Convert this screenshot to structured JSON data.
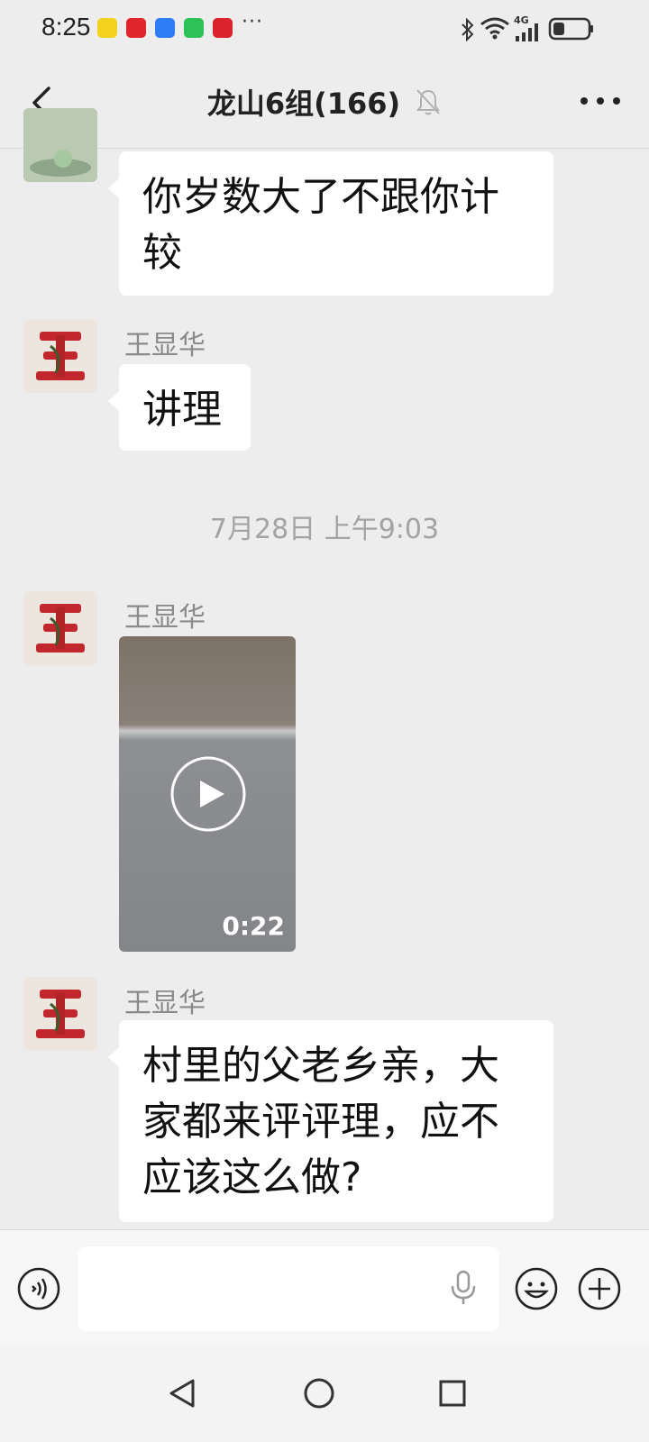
{
  "status_bar": {
    "time": "8:25",
    "more_indicator": "···",
    "network_label": "4G",
    "icons": [
      "notification-app-icon",
      "health-app-icon",
      "baidu-app-icon",
      "wechat-app-icon",
      "news-app-icon",
      "bluetooth-icon",
      "wifi-icon",
      "signal-icon",
      "battery-icon"
    ]
  },
  "header": {
    "title": "龙山6组(166)",
    "muted_icon": "bell-muted-icon",
    "back_icon": "back-chevron-icon",
    "more_icon": "more-dots-icon"
  },
  "messages": [
    {
      "type": "text",
      "sender": "",
      "text_lines": [
        "你岁数大了不跟你计",
        "较"
      ]
    },
    {
      "type": "text",
      "sender": "王显华",
      "text_lines": [
        "讲理"
      ]
    },
    {
      "type": "timestamp",
      "text": "7月28日 上午9:03"
    },
    {
      "type": "video",
      "sender": "王显华",
      "duration": "0:22"
    },
    {
      "type": "text",
      "sender": "王显华",
      "text_lines": [
        "村里的父老乡亲，大",
        "家都来评评理，应不",
        "应该这么做?"
      ]
    }
  ],
  "input_bar": {
    "value": "",
    "placeholder": "",
    "icons": [
      "voice-icon",
      "microphone-icon",
      "emoji-icon",
      "plus-icon"
    ]
  },
  "system_nav": {
    "icons": [
      "back-triangle-icon",
      "home-circle-icon",
      "recents-square-icon"
    ]
  },
  "colors": {
    "background": "#ededed",
    "bubble": "#ffffff",
    "avatar_red": "#c1272d",
    "muted_text": "#8a8a8a"
  }
}
